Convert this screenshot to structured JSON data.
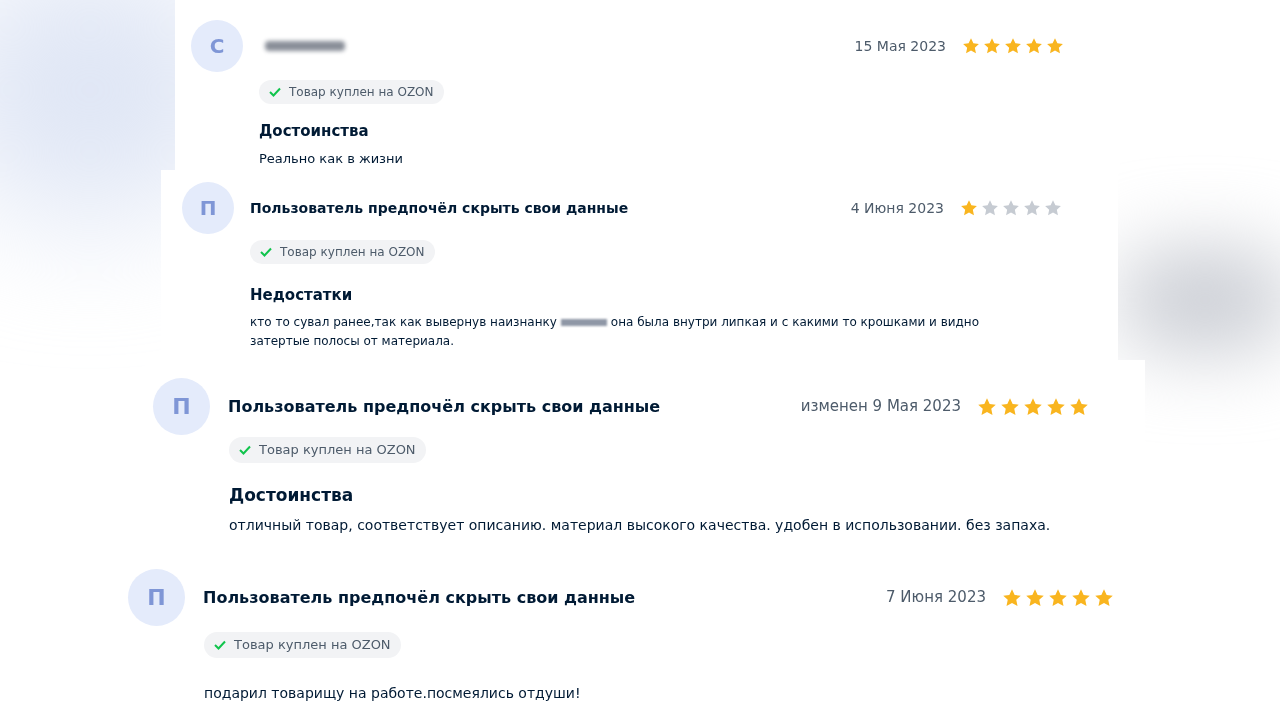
{
  "reviews": [
    {
      "avatar_letter": "С",
      "author_blurred": true,
      "date": "15 Мая 2023",
      "stars": 5,
      "badge": "Товар куплен на OZON",
      "section_title": "Достоинства",
      "text": [
        "Реально как в жизни"
      ],
      "redacted_word": false
    },
    {
      "avatar_letter": "П",
      "author_blurred": false,
      "author": "Пользователь предпочёл скрыть свои данные",
      "date": "4 Июня 2023",
      "stars": 1,
      "badge": "Товар куплен на OZON",
      "section_title": "Недостатки",
      "text": [
        "кто то сувал ранее,так как вывернув наизнанку",
        "она была внутри липкая и с какими то крошками и видно",
        "затертые полосы от материала."
      ],
      "redacted_word": true
    },
    {
      "avatar_letter": "П",
      "author_blurred": false,
      "author": "Пользователь предпочёл скрыть свои данные",
      "date": "изменен 9 Мая 2023",
      "stars": 5,
      "badge": "Товар куплен на OZON",
      "section_title": "Достоинства",
      "text": [
        "отличный товар, соответствует описанию. материал высокого качества. удобен в использовании. без запаха."
      ],
      "redacted_word": false
    },
    {
      "avatar_letter": "П",
      "author_blurred": false,
      "author": "Пользователь предпочёл скрыть свои данные",
      "date": "7 Июня 2023",
      "stars": 5,
      "badge": "Товар куплен на OZON",
      "text": [
        "подарил товарищу на работе.посмеялись отдуши!"
      ],
      "redacted_word": false
    }
  ]
}
